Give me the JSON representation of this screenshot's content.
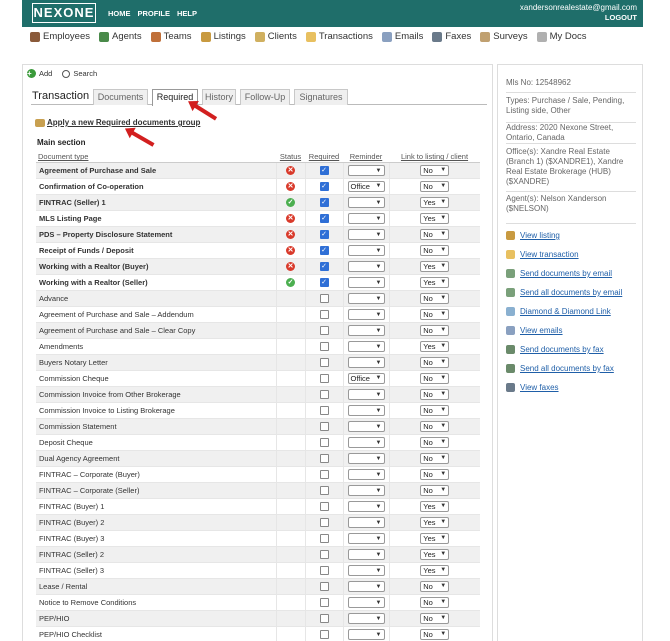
{
  "header": {
    "logo": "NEXONE",
    "nav": [
      "HOME",
      "PROFILE",
      "HELP"
    ],
    "user_email": "xandersonrealestate@gmail.com",
    "logout": "LOGOUT"
  },
  "modules": [
    "Employees",
    "Agents",
    "Teams",
    "Listings",
    "Clients",
    "Transactions",
    "Emails",
    "Faxes",
    "Surveys",
    "My Docs"
  ],
  "toolbar": {
    "add": "Add",
    "search": "Search"
  },
  "tabs": {
    "title": "Transaction",
    "items": [
      "Documents",
      "Required",
      "History",
      "Follow-Up",
      "Signatures"
    ],
    "active": "Required"
  },
  "apply_link": "Apply a new Required documents group",
  "section": "Main section",
  "table": {
    "headers": [
      "Document type",
      "Status",
      "Required",
      "Reminder",
      "Link to listing / client"
    ],
    "rows": [
      {
        "name": "Agreement of Purchase and Sale",
        "bold": true,
        "status": "x",
        "required": true,
        "reminder": "",
        "link": "No"
      },
      {
        "name": "Confirmation of Co-operation",
        "bold": true,
        "status": "x",
        "required": true,
        "reminder": "Office",
        "link": "No"
      },
      {
        "name": "FINTRAC (Seller) 1",
        "bold": true,
        "status": "ok",
        "required": true,
        "reminder": "",
        "link": "Yes"
      },
      {
        "name": "MLS Listing Page",
        "bold": true,
        "status": "x",
        "required": true,
        "reminder": "",
        "link": "Yes"
      },
      {
        "name": "PDS – Property Disclosure Statement",
        "bold": true,
        "status": "x",
        "required": true,
        "reminder": "",
        "link": "No"
      },
      {
        "name": "Receipt of Funds / Deposit",
        "bold": true,
        "status": "x",
        "required": true,
        "reminder": "",
        "link": "No"
      },
      {
        "name": "Working with a Realtor (Buyer)",
        "bold": true,
        "status": "x",
        "required": true,
        "reminder": "",
        "link": "Yes"
      },
      {
        "name": "Working with a Realtor (Seller)",
        "bold": true,
        "status": "ok",
        "required": true,
        "reminder": "",
        "link": "Yes"
      },
      {
        "name": "Advance",
        "bold": false,
        "status": "",
        "required": false,
        "reminder": "",
        "link": "No"
      },
      {
        "name": "Agreement of Purchase and Sale – Addendum",
        "bold": false,
        "status": "",
        "required": false,
        "reminder": "",
        "link": "No"
      },
      {
        "name": "Agreement of Purchase and Sale – Clear Copy",
        "bold": false,
        "status": "",
        "required": false,
        "reminder": "",
        "link": "No"
      },
      {
        "name": "Amendments",
        "bold": false,
        "status": "",
        "required": false,
        "reminder": "",
        "link": "Yes"
      },
      {
        "name": "Buyers Notary Letter",
        "bold": false,
        "status": "",
        "required": false,
        "reminder": "",
        "link": "No"
      },
      {
        "name": "Commission Cheque",
        "bold": false,
        "status": "",
        "required": false,
        "reminder": "Office",
        "link": "No"
      },
      {
        "name": "Commission Invoice from Other Brokerage",
        "bold": false,
        "status": "",
        "required": false,
        "reminder": "",
        "link": "No"
      },
      {
        "name": "Commission Invoice to Listing Brokerage",
        "bold": false,
        "status": "",
        "required": false,
        "reminder": "",
        "link": "No"
      },
      {
        "name": "Commission Statement",
        "bold": false,
        "status": "",
        "required": false,
        "reminder": "",
        "link": "No"
      },
      {
        "name": "Deposit Cheque",
        "bold": false,
        "status": "",
        "required": false,
        "reminder": "",
        "link": "No"
      },
      {
        "name": "Dual Agency Agreement",
        "bold": false,
        "status": "",
        "required": false,
        "reminder": "",
        "link": "No"
      },
      {
        "name": "FINTRAC – Corporate (Buyer)",
        "bold": false,
        "status": "",
        "required": false,
        "reminder": "",
        "link": "No"
      },
      {
        "name": "FINTRAC – Corporate (Seller)",
        "bold": false,
        "status": "",
        "required": false,
        "reminder": "",
        "link": "No"
      },
      {
        "name": "FINTRAC (Buyer) 1",
        "bold": false,
        "status": "",
        "required": false,
        "reminder": "",
        "link": "Yes"
      },
      {
        "name": "FINTRAC (Buyer) 2",
        "bold": false,
        "status": "",
        "required": false,
        "reminder": "",
        "link": "Yes"
      },
      {
        "name": "FINTRAC (Buyer) 3",
        "bold": false,
        "status": "",
        "required": false,
        "reminder": "",
        "link": "Yes"
      },
      {
        "name": "FINTRAC (Seller) 2",
        "bold": false,
        "status": "",
        "required": false,
        "reminder": "",
        "link": "Yes"
      },
      {
        "name": "FINTRAC (Seller) 3",
        "bold": false,
        "status": "",
        "required": false,
        "reminder": "",
        "link": "Yes"
      },
      {
        "name": "Lease / Rental",
        "bold": false,
        "status": "",
        "required": false,
        "reminder": "",
        "link": "No"
      },
      {
        "name": "Notice to Remove Conditions",
        "bold": false,
        "status": "",
        "required": false,
        "reminder": "",
        "link": "No"
      },
      {
        "name": "PEP/HIO",
        "bold": false,
        "status": "",
        "required": false,
        "reminder": "",
        "link": "No"
      },
      {
        "name": "PEP/HIO Checklist",
        "bold": false,
        "status": "",
        "required": false,
        "reminder": "",
        "link": "No"
      }
    ]
  },
  "side": {
    "mls": "Mls No:  12548962",
    "types": "Types: Purchase / Sale, Pending, Listing side, Other",
    "address": "Address: 2020 Nexone Street, Ontario, Canada",
    "offices": "Office(s): Xandre Real Estate (Branch 1) ($XANDRE1), Xandre Real Estate Brokerage (HUB) ($XANDRE)",
    "agents": "Agent(s): Nelson Xanderson ($NELSON)",
    "actions": [
      "View listing",
      "View transaction",
      "Send documents by email",
      "Send all documents by email",
      "Diamond & Diamond Link",
      "View emails",
      "Send documents by fax",
      "Send all documents by fax",
      "View faxes"
    ]
  },
  "colors": {
    "header": "#1f6e6a",
    "link": "#1f5fa8",
    "error": "#d93a2b",
    "ok": "#4caf50",
    "arrow": "#d21f1f"
  }
}
